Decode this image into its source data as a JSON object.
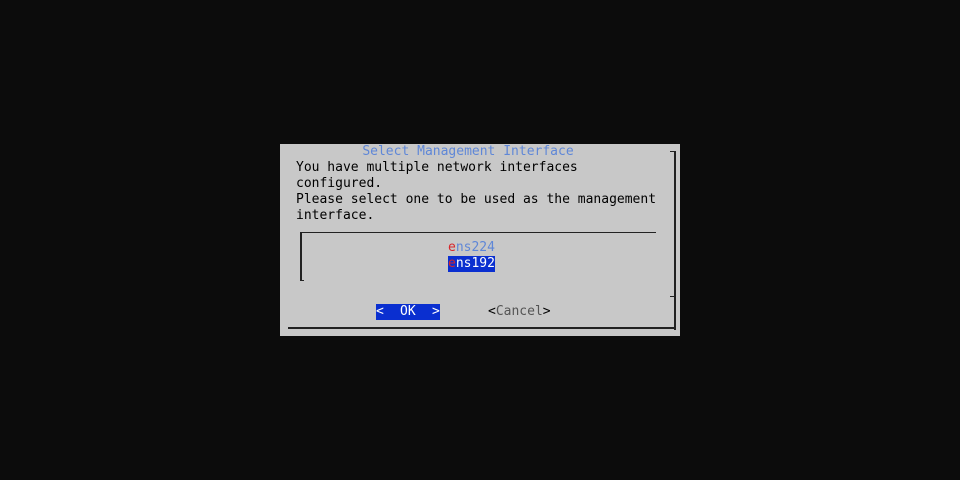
{
  "dialog": {
    "title": "Select Management Interface",
    "message_lines": [
      "You have multiple network interfaces",
      "configured.",
      "Please select one to be used as the management",
      "interface."
    ],
    "list_items": [
      {
        "hotkey": "e",
        "rest": "ns224",
        "selected": false
      },
      {
        "hotkey": "e",
        "rest": "ns192",
        "selected": true
      }
    ],
    "buttons": {
      "ok_left": "<",
      "ok_label": "OK",
      "ok_right": ">",
      "cancel_left": "<",
      "cancel_label": "Cancel",
      "cancel_right": ">"
    }
  },
  "colors": {
    "background": "#0c0c0c",
    "dialog": "#c8c8c8",
    "title": "#5f87d7",
    "selection": "#0a2fd0",
    "hotkey": "#d7262b"
  }
}
